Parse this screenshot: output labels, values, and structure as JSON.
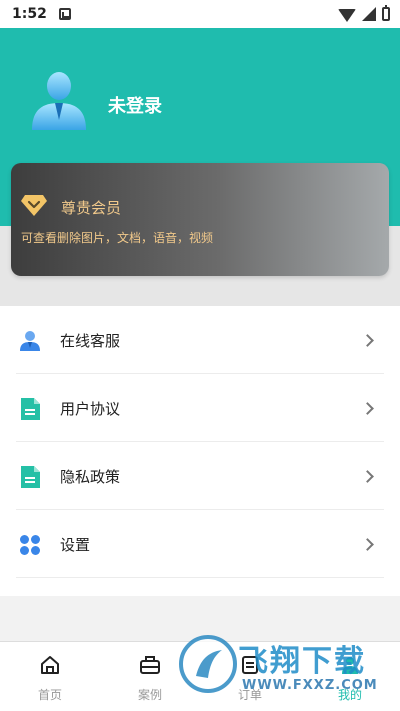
{
  "status_bar": {
    "time": "1:52"
  },
  "profile": {
    "login_status": "未登录"
  },
  "vip": {
    "title": "尊贵会员",
    "description": "可查看删除图片，文档，语音，视频",
    "accent_color": "#f1c98b"
  },
  "menu": {
    "items": [
      {
        "label": "在线客服",
        "icon": "customer-service-icon"
      },
      {
        "label": "用户协议",
        "icon": "document-icon"
      },
      {
        "label": "隐私政策",
        "icon": "document-icon"
      },
      {
        "label": "设置",
        "icon": "settings-grid-icon"
      }
    ]
  },
  "bottom_nav": {
    "items": [
      {
        "label": "首页",
        "icon": "home-icon"
      },
      {
        "label": "案例",
        "icon": "case-icon"
      },
      {
        "label": "订单",
        "icon": "order-icon"
      },
      {
        "label": "我的",
        "icon": "profile-icon",
        "active": true
      }
    ]
  },
  "watermark": {
    "text": "飞翔下载",
    "url": "WWW.FXXZ.COM"
  },
  "colors": {
    "brand": "#1fbcae",
    "icon_blue": "#3a86e8"
  }
}
